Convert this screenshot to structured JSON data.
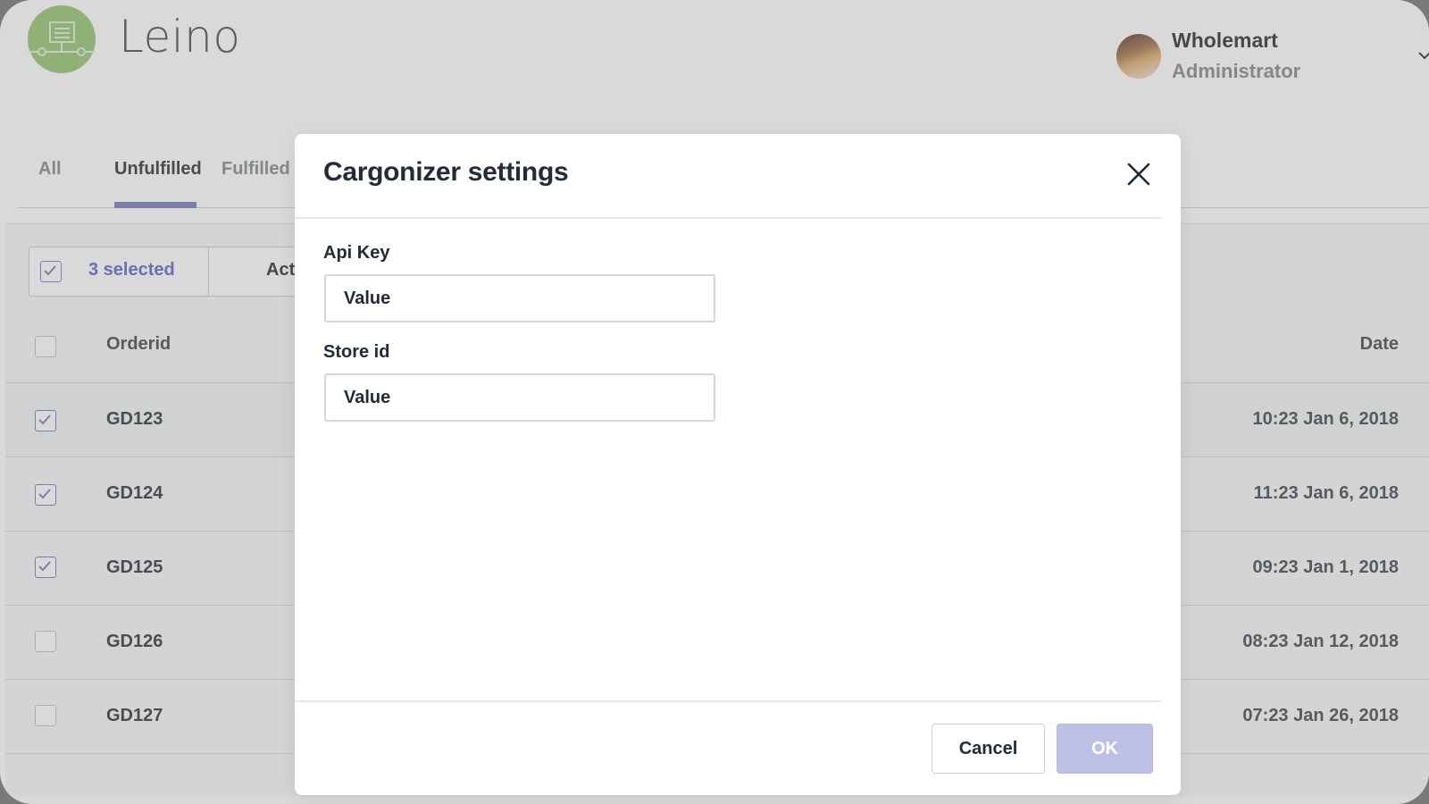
{
  "app": {
    "brand": "Leino",
    "logo_icon": "monitor-network-icon",
    "accent_color": "#9196c8",
    "logo_color": "#a8d08d"
  },
  "user": {
    "name": "Wholemart",
    "role": "Administrator",
    "menu_icon": "chevron-down-icon"
  },
  "tabs": [
    {
      "label": "All",
      "active": false
    },
    {
      "label": "Unfulfilled",
      "active": true
    },
    {
      "label": "Fulfilled o",
      "active": false
    }
  ],
  "bulk_bar": {
    "selected_label": "3 selected",
    "actions_label": "Act"
  },
  "table": {
    "columns": [
      "Orderid",
      "Date"
    ],
    "rows": [
      {
        "orderid": "GD123",
        "date": "10:23 Jan 6, 2018",
        "checked": true
      },
      {
        "orderid": "GD124",
        "date": "11:23 Jan 6, 2018",
        "checked": true
      },
      {
        "orderid": "GD125",
        "date": "09:23 Jan 1, 2018",
        "checked": true
      },
      {
        "orderid": "GD126",
        "date": "08:23 Jan 12, 2018",
        "checked": false
      },
      {
        "orderid": "GD127",
        "date": "07:23 Jan 26, 2018",
        "checked": false
      }
    ]
  },
  "modal": {
    "title": "Cargonizer settings",
    "close_icon": "close-icon",
    "fields": [
      {
        "label": "Api Key",
        "value": "Value"
      },
      {
        "label": "Store id",
        "value": "Value"
      }
    ],
    "cancel_label": "Cancel",
    "ok_label": "OK"
  }
}
